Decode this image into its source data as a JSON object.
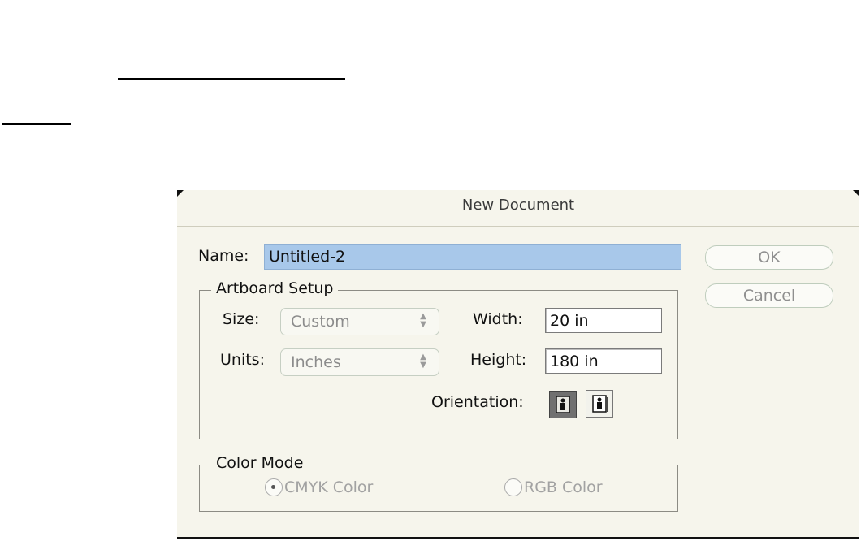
{
  "dialog": {
    "title": "New Document",
    "name_label": "Name:",
    "name_value": "Untitled-2",
    "ok_label": "OK",
    "cancel_label": "Cancel"
  },
  "artboard": {
    "group_title": "Artboard Setup",
    "size_label": "Size:",
    "size_value": "Custom",
    "units_label": "Units:",
    "units_value": "Inches",
    "width_label": "Width:",
    "width_value": "20 in",
    "height_label": "Height:",
    "height_value": "180 in",
    "orientation_label": "Orientation:",
    "orientation_selected": "portrait"
  },
  "color_mode": {
    "group_title": "Color Mode",
    "options": [
      {
        "label": "CMYK Color",
        "selected": true
      },
      {
        "label": "RGB Color",
        "selected": false
      }
    ]
  },
  "icons": {
    "stepper": "up-down-arrows-icon",
    "portrait": "portrait-orientation-icon",
    "landscape": "landscape-orientation-icon"
  },
  "colors": {
    "name_highlight": "#a8c8ea",
    "dialog_bg": "#f6f5ec"
  }
}
